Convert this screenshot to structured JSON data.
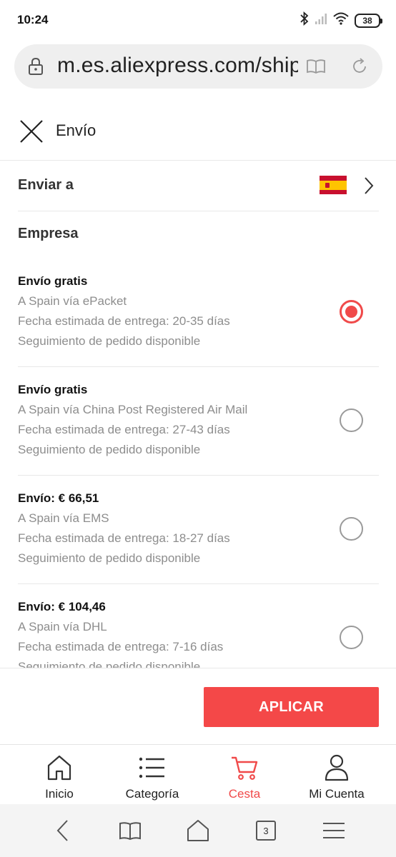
{
  "status_bar": {
    "time": "10:24",
    "battery": "38",
    "icons": [
      "bluetooth-icon",
      "signal-icon",
      "wifi-icon",
      "battery-icon"
    ]
  },
  "browser": {
    "url": "m.es.aliexpress.com/shipping",
    "icons": [
      "lock-icon",
      "reader-icon",
      "reload-icon"
    ]
  },
  "header": {
    "title": "Envío",
    "close_icon": "close-icon"
  },
  "ship_to": {
    "label": "Enviar a",
    "country_flag": "spain-flag-icon"
  },
  "company": {
    "label": "Empresa"
  },
  "options": [
    {
      "title": "Envío gratis",
      "carrier": "A Spain vía ePacket",
      "delivery": "Fecha estimada de entrega: 20-35 días",
      "tracking": "Seguimiento de pedido disponible",
      "selected": true
    },
    {
      "title": "Envío gratis",
      "carrier": "A Spain vía China Post Registered Air Mail",
      "delivery": "Fecha estimada de entrega: 27-43 días",
      "tracking": "Seguimiento de pedido disponible",
      "selected": false
    },
    {
      "title": "Envío: € 66,51",
      "carrier": "A Spain vía EMS",
      "delivery": "Fecha estimada de entrega: 18-27 días",
      "tracking": "Seguimiento de pedido disponible",
      "selected": false
    },
    {
      "title": "Envío: € 104,46",
      "carrier": "A Spain vía DHL",
      "delivery": "Fecha estimada de entrega: 7-16 días",
      "tracking": "Seguimiento de pedido disponible",
      "selected": false
    }
  ],
  "apply_button": "APLICAR",
  "bottom_nav": [
    {
      "label": "Inicio",
      "icon": "home-icon",
      "active": false
    },
    {
      "label": "Categoría",
      "icon": "list-icon",
      "active": false
    },
    {
      "label": "Cesta",
      "icon": "cart-icon",
      "active": true
    },
    {
      "label": "Mi Cuenta",
      "icon": "user-icon",
      "active": false
    }
  ],
  "system_nav": {
    "tabs_count": "3",
    "icons": [
      "back-icon",
      "bookmarks-icon",
      "home-icon",
      "tabs-icon",
      "menu-icon"
    ]
  },
  "colors": {
    "accent": "#f04a4a",
    "text_primary": "#222222",
    "text_secondary": "#8d8d8d",
    "divider": "#e8e8e8",
    "url_bar_bg": "#efefef"
  }
}
